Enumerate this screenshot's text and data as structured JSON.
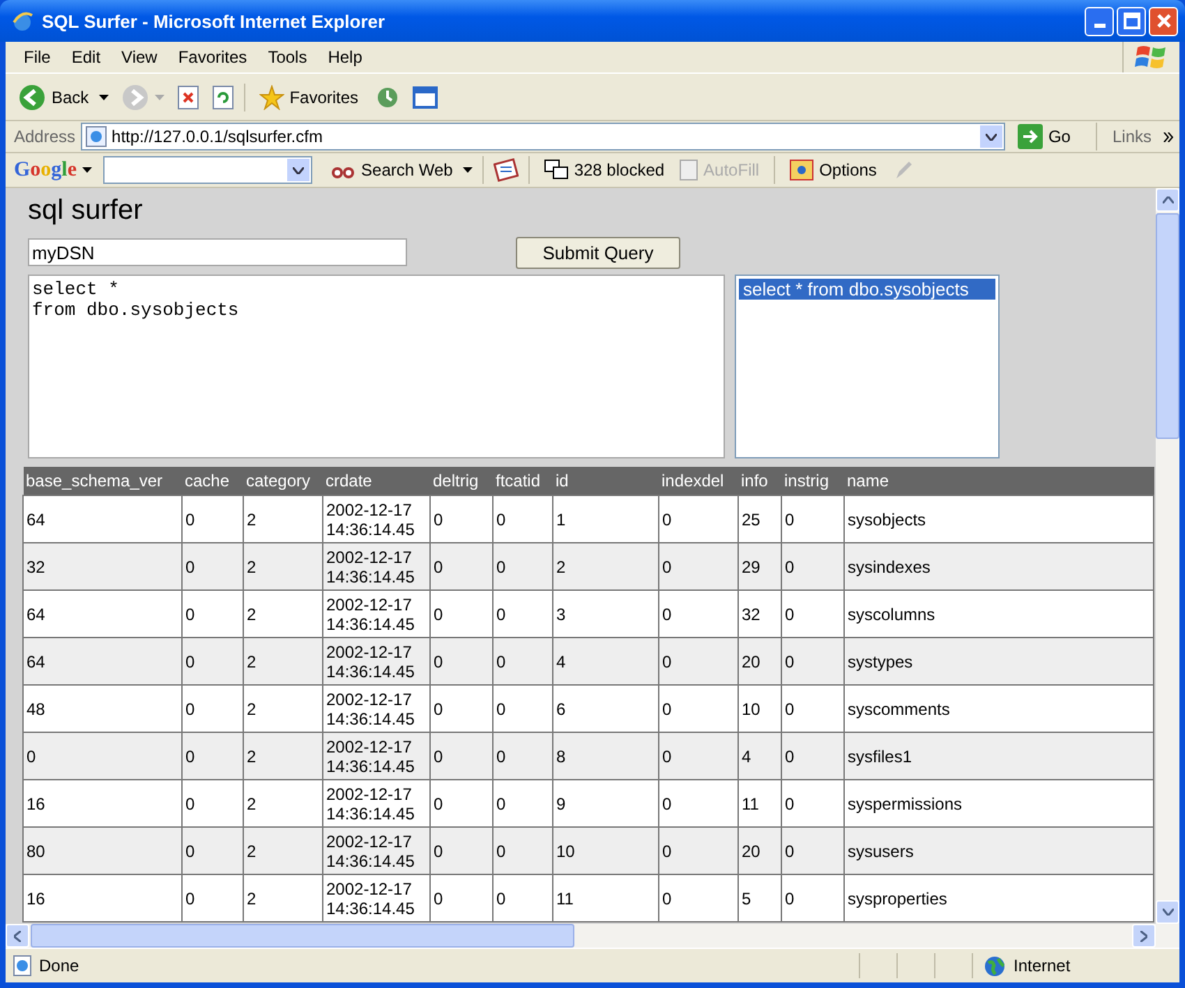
{
  "window": {
    "title": "SQL Surfer - Microsoft Internet Explorer"
  },
  "menu": [
    "File",
    "Edit",
    "View",
    "Favorites",
    "Tools",
    "Help"
  ],
  "toolbar": {
    "back": "Back",
    "favorites": "Favorites"
  },
  "address": {
    "label": "Address",
    "url": "http://127.0.0.1/sqlsurfer.cfm",
    "go": "Go",
    "links": "Links"
  },
  "google_bar": {
    "logo": "Google",
    "search": "Search Web",
    "blocked": "328 blocked",
    "autofill": {
      "label": "AutoFill",
      "disabled": true
    },
    "options": "Options"
  },
  "page": {
    "heading": "sql surfer",
    "dsn": "myDSN",
    "submit": "Submit Query",
    "query": "select *\nfrom dbo.sysobjects",
    "history": [
      {
        "text": "select * from dbo.sysobjects",
        "selected": true
      }
    ]
  },
  "table": {
    "columns": [
      "base_schema_ver",
      "cache",
      "category",
      "crdate",
      "deltrig",
      "ftcatid",
      "id",
      "indexdel",
      "info",
      "instrig",
      "name"
    ],
    "rows": [
      [
        "64",
        "0",
        "2",
        "2002-12-17 14:36:14.45",
        "0",
        "0",
        "1",
        "0",
        "25",
        "0",
        "sysobjects"
      ],
      [
        "32",
        "0",
        "2",
        "2002-12-17 14:36:14.45",
        "0",
        "0",
        "2",
        "0",
        "29",
        "0",
        "sysindexes"
      ],
      [
        "64",
        "0",
        "2",
        "2002-12-17 14:36:14.45",
        "0",
        "0",
        "3",
        "0",
        "32",
        "0",
        "syscolumns"
      ],
      [
        "64",
        "0",
        "2",
        "2002-12-17 14:36:14.45",
        "0",
        "0",
        "4",
        "0",
        "20",
        "0",
        "systypes"
      ],
      [
        "48",
        "0",
        "2",
        "2002-12-17 14:36:14.45",
        "0",
        "0",
        "6",
        "0",
        "10",
        "0",
        "syscomments"
      ],
      [
        "0",
        "0",
        "2",
        "2002-12-17 14:36:14.45",
        "0",
        "0",
        "8",
        "0",
        "4",
        "0",
        "sysfiles1"
      ],
      [
        "16",
        "0",
        "2",
        "2002-12-17 14:36:14.45",
        "0",
        "0",
        "9",
        "0",
        "11",
        "0",
        "syspermissions"
      ],
      [
        "80",
        "0",
        "2",
        "2002-12-17 14:36:14.45",
        "0",
        "0",
        "10",
        "0",
        "20",
        "0",
        "sysusers"
      ],
      [
        "16",
        "0",
        "2",
        "2002-12-17 14:36:14.45",
        "0",
        "0",
        "11",
        "0",
        "5",
        "0",
        "sysproperties"
      ]
    ]
  },
  "status_bar": {
    "text": "Done",
    "zone": "Internet"
  }
}
